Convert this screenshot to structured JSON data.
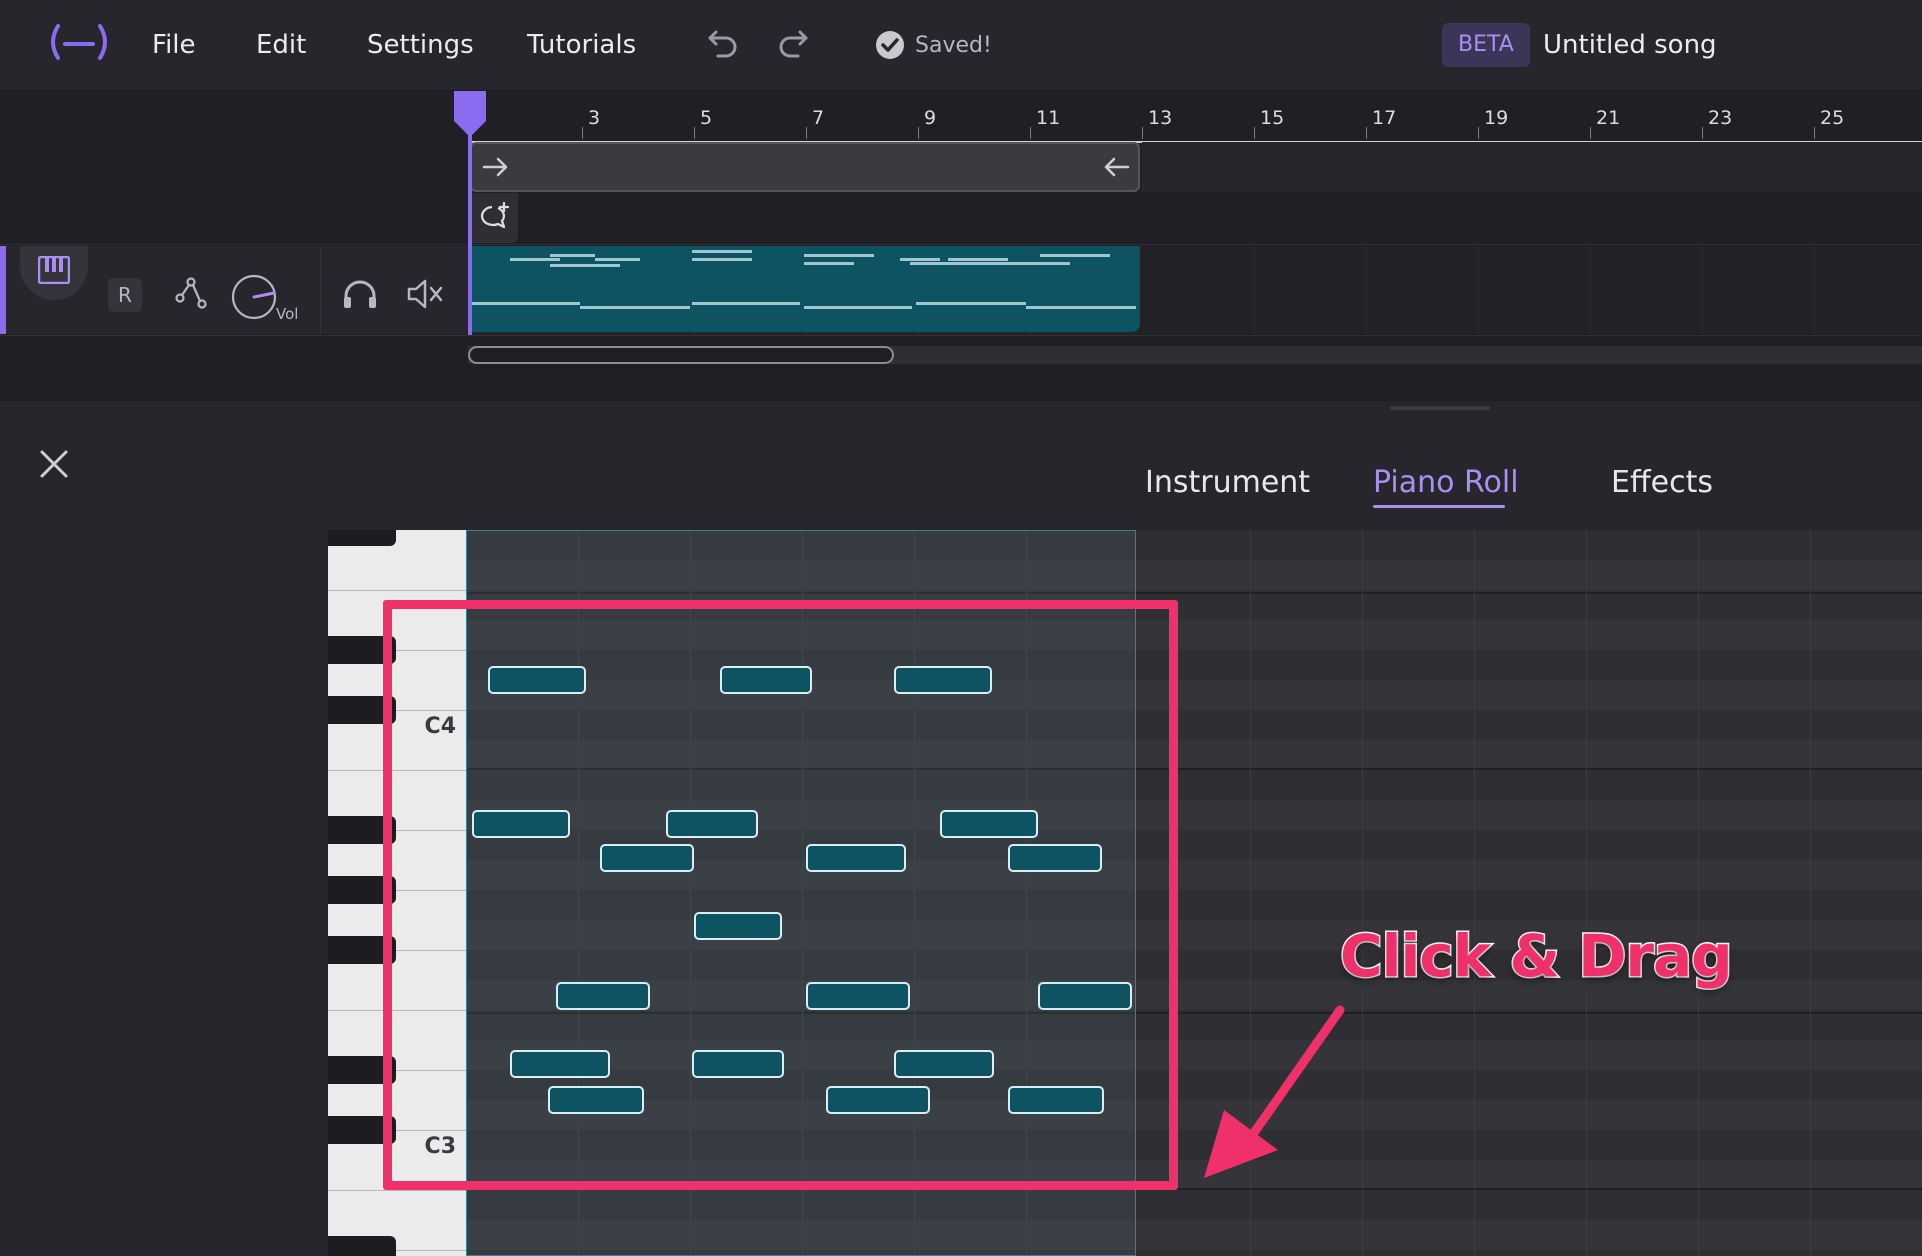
{
  "header": {
    "menu": [
      "File",
      "Edit",
      "Settings",
      "Tutorials"
    ],
    "saved_text": "Saved!",
    "beta_label": "BETA",
    "song_title": "Untitled song"
  },
  "timeline": {
    "ruler_labels": [
      "3",
      "5",
      "7",
      "9",
      "11",
      "13",
      "15",
      "17",
      "19",
      "21",
      "23",
      "25"
    ]
  },
  "track": {
    "record_label": "R",
    "volume_label": "Vol"
  },
  "panel": {
    "tabs": [
      "Instrument",
      "Piano Roll",
      "Effects"
    ],
    "active_tab": "Piano Roll"
  },
  "piano": {
    "labels": [
      "C4",
      "C3"
    ]
  },
  "annotation": {
    "text": "Click & Drag"
  },
  "colors": {
    "accent": "#a88ff0",
    "note_fill": "#0d5362",
    "annotation": "#f0306a"
  }
}
